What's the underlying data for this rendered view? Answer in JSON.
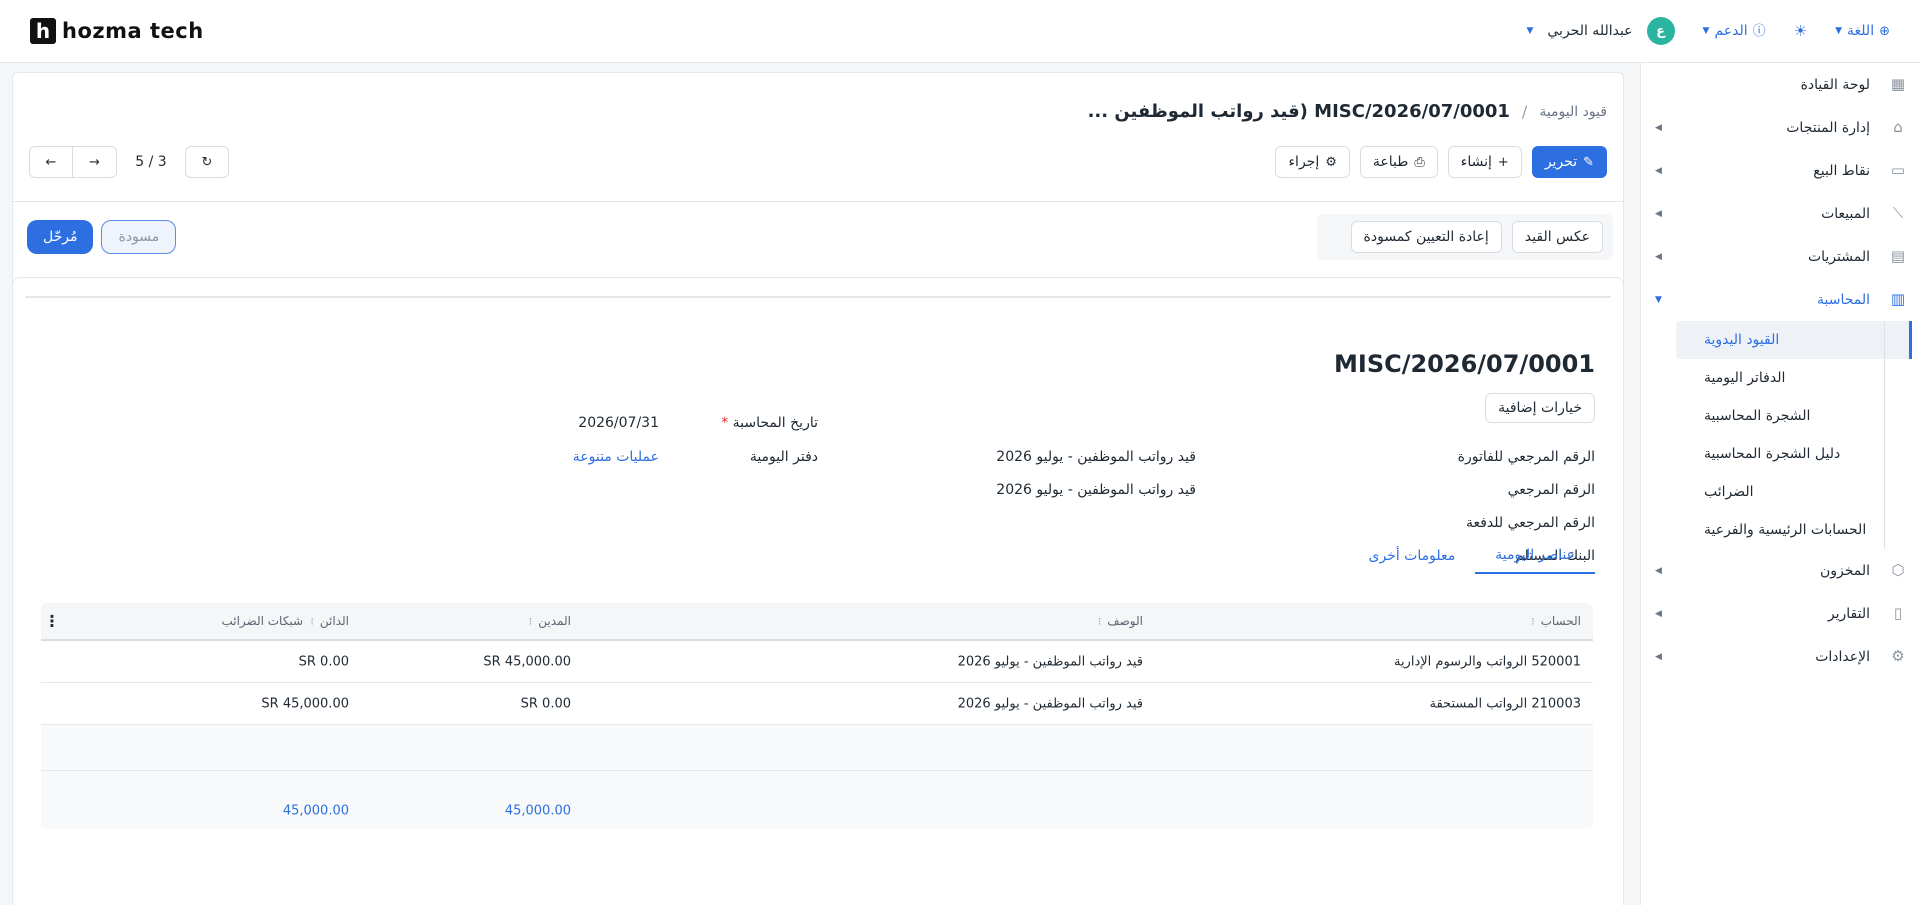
{
  "brand": {
    "mark": "h",
    "name": "hozma tech"
  },
  "header": {
    "user_name": "عبدالله الحربي",
    "avatar_letter": "ع",
    "support_label": "الدعم",
    "language_label": "اللغة"
  },
  "sidebar": {
    "items": [
      {
        "label": "لوحة القيادة",
        "icon": "dashboard-icon"
      },
      {
        "label": "إدارة المنتجات",
        "icon": "tag-icon"
      },
      {
        "label": "نقاط البيع",
        "icon": "store-icon"
      },
      {
        "label": "المبيعات",
        "icon": "chart-icon"
      },
      {
        "label": "المشتريات",
        "icon": "purchase-icon"
      },
      {
        "label": "المحاسبة",
        "icon": "accounting-icon"
      },
      {
        "label": "المخزون",
        "icon": "box-icon"
      },
      {
        "label": "التقارير",
        "icon": "report-icon"
      },
      {
        "label": "الإعدادات",
        "icon": "settings-icon"
      }
    ],
    "accounting_sub": [
      "القيود اليدوية",
      "الدفاتر اليومية",
      "الشجرة المحاسبية",
      "دليل الشجرة المحاسبية",
      "الضرائب",
      "الحسابات الرئيسية والفرعية"
    ]
  },
  "breadcrumb": {
    "parent": "قيود اليومية",
    "separator": "/",
    "current": "MISC/2026/07/0001 (قيد رواتب الموظفين ..."
  },
  "actions": {
    "edit": "تحرير",
    "create": "إنشاء",
    "print": "طباعة",
    "action": "إجراء"
  },
  "pager": {
    "count": "5 / 3"
  },
  "states": {
    "posted": "مُرحّل",
    "draft": "مسودة"
  },
  "entry_buttons": {
    "reverse": "عكس القيد",
    "reset_draft": "إعادة التعيين كمسودة"
  },
  "form": {
    "title": "MISC/2026/07/0001",
    "extra_options": "خيارات إضافية",
    "invoice_ref_label": "الرقم المرجعي للفاتورة",
    "invoice_ref_value": "قيد رواتب الموظفين - يوليو 2026",
    "ref_label": "الرقم المرجعي",
    "ref_value": "قيد رواتب الموظفين - يوليو 2026",
    "payment_ref_label": "الرقم المرجعي للدفعة",
    "bank_label": "البنك المستلم",
    "date_label": "تاريخ المحاسبة",
    "date_required": "*",
    "date_value": "2026/07/31",
    "journal_label": "دفتر اليومية",
    "journal_value": "عمليات متنوعة"
  },
  "tabs": {
    "items": "عناصر اليومية",
    "other": "معلومات أخرى"
  },
  "table": {
    "headers": {
      "account": "الحساب",
      "description": "الوصف",
      "debit": "المدين",
      "credit": "الدائن",
      "tax_grids": "شبكات الضرائب"
    },
    "rows": [
      {
        "account": "520001 الرواتب والرسوم الإدارية",
        "description": "قيد رواتب الموظفين - يوليو 2026",
        "debit": "SR 45,000.00",
        "credit": "SR 0.00"
      },
      {
        "account": "210003 الرواتب المستحقة",
        "description": "قيد رواتب الموظفين - يوليو 2026",
        "debit": "SR 0.00",
        "credit": "SR 45,000.00"
      }
    ],
    "totals": {
      "debit": "45,000.00",
      "credit": "45,000.00"
    }
  }
}
